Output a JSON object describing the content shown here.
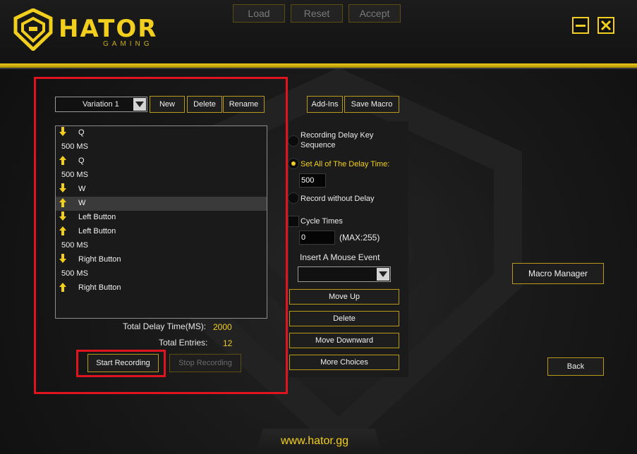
{
  "brand": {
    "name": "HATOR",
    "sub": "GAMING",
    "url": "www.hator.gg",
    "accent": "#f2cf1e"
  },
  "top_bar": {
    "load": "Load",
    "reset": "Reset",
    "accept": "Accept"
  },
  "window_controls": {
    "minimize_icon": "minimize-icon",
    "close_icon": "close-icon"
  },
  "variation": {
    "selected": "Variation 1"
  },
  "actions": {
    "new": "New",
    "delete": "Delete",
    "rename": "Rename",
    "add_ins": "Add-Ins",
    "save_macro": "Save Macro"
  },
  "macro_list": [
    {
      "icon": "down-arrow",
      "text": "Q"
    },
    {
      "icon": "",
      "text": "500 MS"
    },
    {
      "icon": "up-arrow",
      "text": "Q"
    },
    {
      "icon": "",
      "text": "500 MS"
    },
    {
      "icon": "down-arrow",
      "text": "W"
    },
    {
      "icon": "up-arrow",
      "text": "W",
      "selected": true
    },
    {
      "icon": "down-arrow",
      "text": "Left Button"
    },
    {
      "icon": "up-arrow",
      "text": "Left Button"
    },
    {
      "icon": "",
      "text": "500 MS"
    },
    {
      "icon": "down-arrow",
      "text": "Right Button"
    },
    {
      "icon": "",
      "text": "500 MS"
    },
    {
      "icon": "up-arrow",
      "text": "Right Button"
    }
  ],
  "stats": {
    "total_delay_label": "Total Delay Time(MS):",
    "total_delay_value": "2000",
    "total_entries_label": "Total Entries:",
    "total_entries_value": "12"
  },
  "recording": {
    "start": "Start Recording",
    "stop": "Stop Recording"
  },
  "options": {
    "recording_delay": "Recording Delay Key Sequence",
    "set_all_delay": "Set All of The Delay Time:",
    "delay_value": "500",
    "record_without_delay": "Record without Delay",
    "cycle_times": "Cycle Times",
    "cycle_value": "0",
    "cycle_max": "(MAX:255)",
    "insert_mouse_event": "Insert A Mouse Event",
    "mouse_event_selected": ""
  },
  "edit_buttons": {
    "move_up": "Move Up",
    "delete": "Delete",
    "move_down": "Move Downward",
    "more": "More Choices"
  },
  "side": {
    "macro_manager": "Macro Manager",
    "back": "Back"
  }
}
